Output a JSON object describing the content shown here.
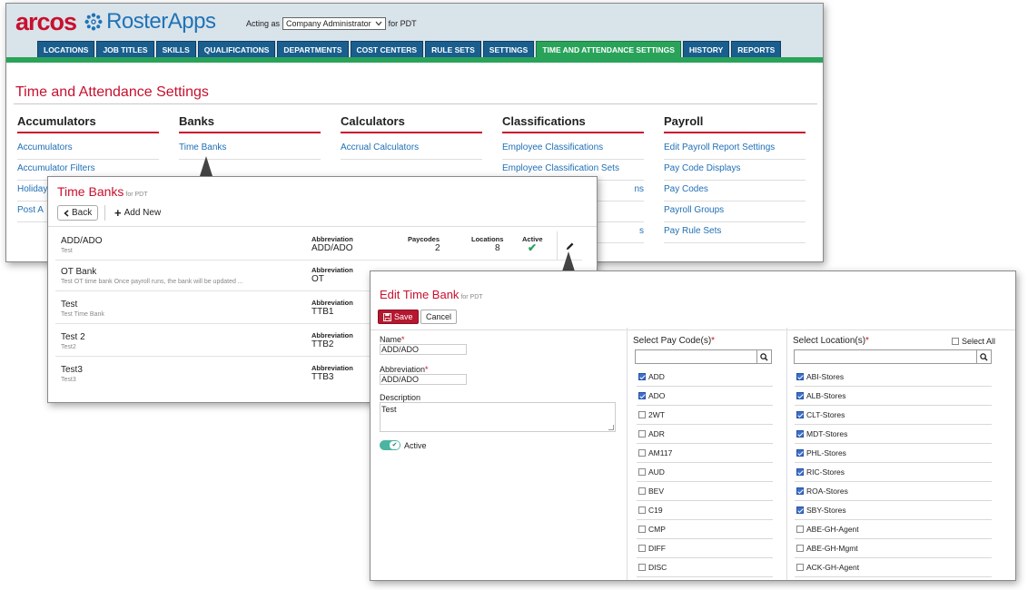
{
  "header": {
    "logo_primary": "arcos",
    "logo_secondary": "RosterApps",
    "acting_prefix": "Acting as",
    "acting_role": "Company Administrator",
    "acting_suffix": "for PDT"
  },
  "nav_tabs": [
    "LOCATIONS",
    "JOB TITLES",
    "SKILLS",
    "QUALIFICATIONS",
    "DEPARTMENTS",
    "COST CENTERS",
    "RULE SETS",
    "SETTINGS",
    "TIME AND ATTENDANCE SETTINGS",
    "HISTORY",
    "REPORTS"
  ],
  "active_tab": "TIME AND ATTENDANCE SETTINGS",
  "page_title": "Time and Attendance Settings",
  "columns": [
    {
      "heading": "Accumulators",
      "links": [
        "Accumulators",
        "Accumulator Filters",
        "Holiday",
        "Post A"
      ]
    },
    {
      "heading": "Banks",
      "links": [
        "Time Banks"
      ]
    },
    {
      "heading": "Calculators",
      "links": [
        "Accrual Calculators"
      ]
    },
    {
      "heading": "Classifications",
      "links": [
        "Employee Classifications",
        "Employee Classification Sets",
        "ns",
        "",
        "s"
      ]
    },
    {
      "heading": "Payroll",
      "links": [
        "Edit Payroll Report Settings",
        "Pay Code Displays",
        "Pay Codes",
        "Payroll Groups",
        "Pay Rule Sets"
      ]
    }
  ],
  "time_banks": {
    "title": "Time Banks",
    "title_suffix": "for PDT",
    "back_label": "Back",
    "add_label": "Add New",
    "headers": {
      "abbreviation": "Abbreviation",
      "paycodes": "Paycodes",
      "locations": "Locations",
      "active": "Active"
    },
    "rows": [
      {
        "name": "ADD/ADO",
        "description": "Test",
        "abbreviation": "ADD/ADO",
        "paycodes": "2",
        "locations": "8",
        "active": true
      },
      {
        "name": "OT Bank",
        "description": "Test OT time bank Once payroll runs, the bank will be updated ...",
        "abbreviation": "OT"
      },
      {
        "name": "Test",
        "description": "Test Time Bank",
        "abbreviation": "TTB1"
      },
      {
        "name": "Test 2",
        "description": "Test2",
        "abbreviation": "TTB2"
      },
      {
        "name": "Test3",
        "description": "Test3",
        "abbreviation": "TTB3"
      }
    ]
  },
  "edit_time_bank": {
    "title": "Edit Time Bank",
    "title_suffix": "for PDT",
    "save_label": "Save",
    "cancel_label": "Cancel",
    "name_label": "Name",
    "name_value": "ADD/ADO",
    "abbreviation_label": "Abbreviation",
    "abbreviation_value": "ADD/ADO",
    "description_label": "Description",
    "description_value": "Test",
    "active_label": "Active",
    "active": true,
    "pay_codes_label": "Select Pay Code(s)",
    "locations_label": "Select Location(s)",
    "select_all_label": "Select All",
    "pay_codes": [
      {
        "label": "ADD",
        "checked": true
      },
      {
        "label": "ADO",
        "checked": true
      },
      {
        "label": "2WT",
        "checked": false
      },
      {
        "label": "ADR",
        "checked": false
      },
      {
        "label": "AM117",
        "checked": false
      },
      {
        "label": "AUD",
        "checked": false
      },
      {
        "label": "BEV",
        "checked": false
      },
      {
        "label": "C19",
        "checked": false
      },
      {
        "label": "CMP",
        "checked": false
      },
      {
        "label": "DIFF",
        "checked": false
      },
      {
        "label": "DISC",
        "checked": false
      }
    ],
    "locations": [
      {
        "label": "ABI-Stores",
        "checked": true
      },
      {
        "label": "ALB-Stores",
        "checked": true
      },
      {
        "label": "CLT-Stores",
        "checked": true
      },
      {
        "label": "MDT-Stores",
        "checked": true
      },
      {
        "label": "PHL-Stores",
        "checked": true
      },
      {
        "label": "RIC-Stores",
        "checked": true
      },
      {
        "label": "ROA-Stores",
        "checked": true
      },
      {
        "label": "SBY-Stores",
        "checked": true
      },
      {
        "label": "ABE-GH-Agent",
        "checked": false
      },
      {
        "label": "ABE-GH-Mgmt",
        "checked": false
      },
      {
        "label": "ACK-GH-Agent",
        "checked": false
      }
    ]
  },
  "colors": {
    "brand_red": "#c8102e",
    "brand_blue": "#1f73b7",
    "tab_blue": "#1a5e8e",
    "accent_green": "#2aa35a"
  }
}
